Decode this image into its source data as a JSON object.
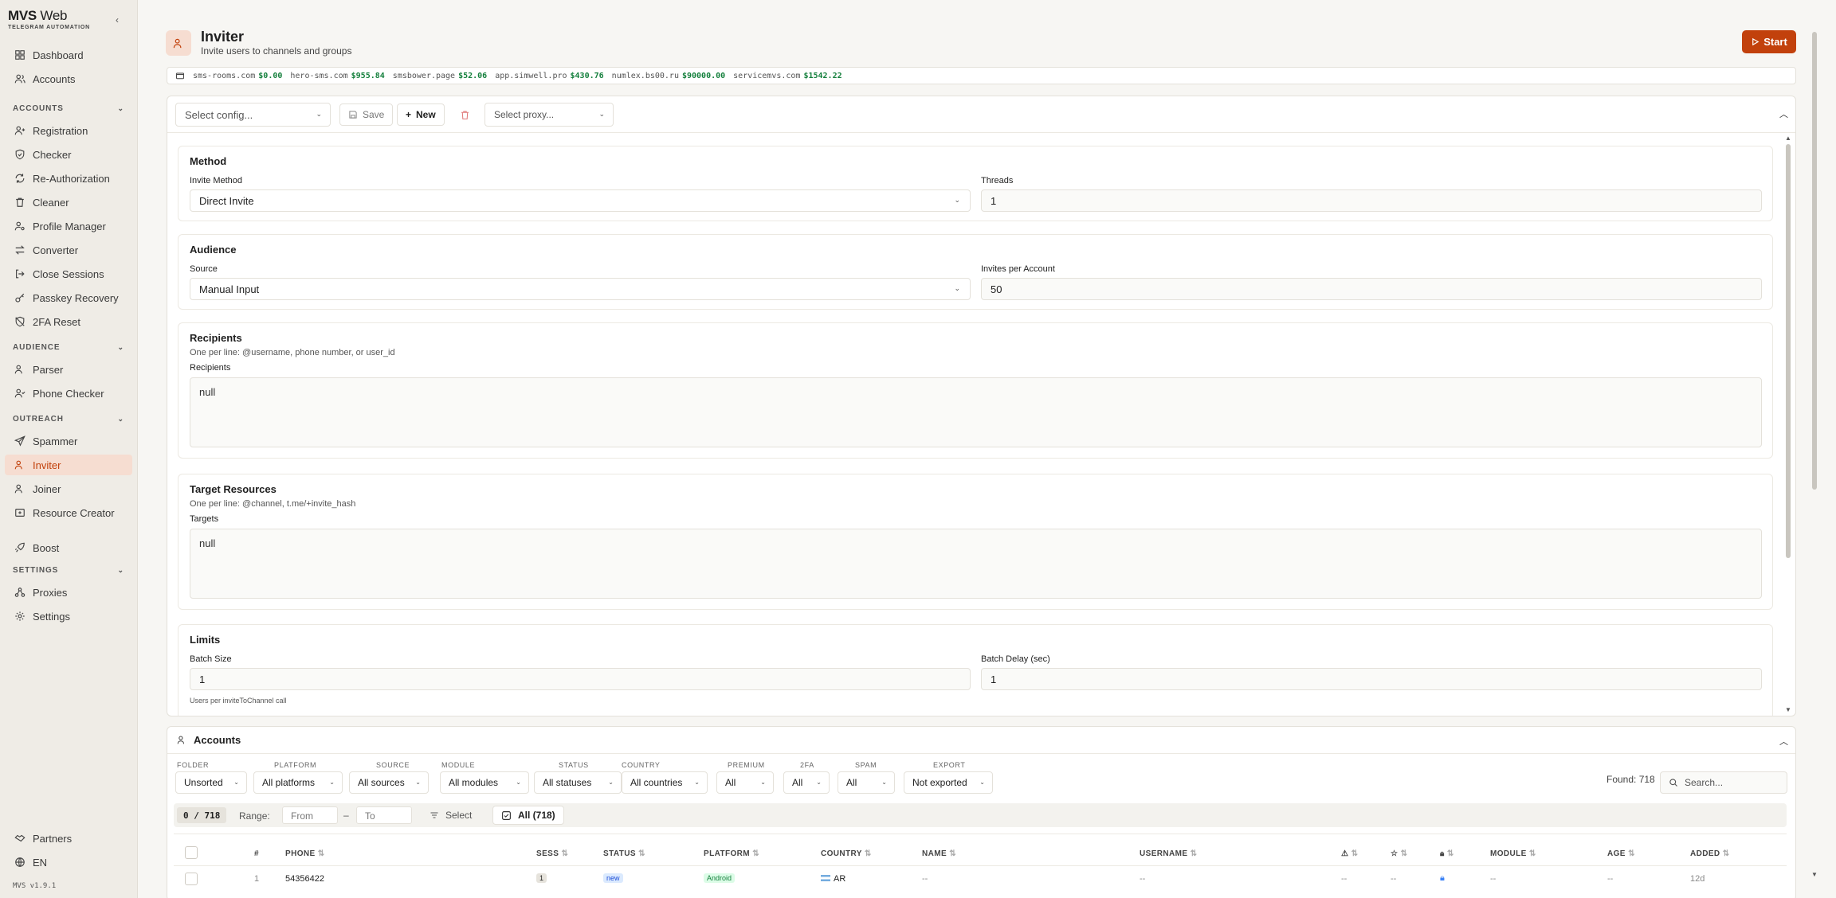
{
  "brand": {
    "name": "MVS",
    "name_suffix": "Web",
    "subtitle": "TELEGRAM AUTOMATION"
  },
  "sidebar": {
    "top": [
      {
        "label": "Dashboard",
        "icon": "dashboard-icon"
      },
      {
        "label": "Accounts",
        "icon": "users-icon"
      }
    ],
    "sections": [
      {
        "title": "ACCOUNTS",
        "items": [
          {
            "label": "Registration",
            "icon": "user-plus-icon"
          },
          {
            "label": "Checker",
            "icon": "shield-check-icon"
          },
          {
            "label": "Re-Authorization",
            "icon": "refresh-icon"
          },
          {
            "label": "Cleaner",
            "icon": "trash-icon"
          },
          {
            "label": "Profile Manager",
            "icon": "user-cog-icon"
          },
          {
            "label": "Converter",
            "icon": "arrows-icon"
          },
          {
            "label": "Close Sessions",
            "icon": "logout-icon"
          },
          {
            "label": "Passkey Recovery",
            "icon": "key-icon"
          },
          {
            "label": "2FA Reset",
            "icon": "shield-off-icon"
          }
        ]
      },
      {
        "title": "AUDIENCE",
        "items": [
          {
            "label": "Parser",
            "icon": "users-icon"
          },
          {
            "label": "Phone Checker",
            "icon": "user-check-icon"
          }
        ]
      },
      {
        "title": "OUTREACH",
        "items": [
          {
            "label": "Spammer",
            "icon": "send-icon"
          },
          {
            "label": "Inviter",
            "icon": "user-plus-icon",
            "active": true
          },
          {
            "label": "Joiner",
            "icon": "users-icon"
          },
          {
            "label": "Resource Creator",
            "icon": "plus-square-icon"
          }
        ]
      }
    ],
    "boost": {
      "label": "Boost",
      "icon": "rocket-icon"
    },
    "settings_section": {
      "title": "SETTINGS",
      "items": [
        {
          "label": "Proxies",
          "icon": "network-icon"
        },
        {
          "label": "Settings",
          "icon": "gear-icon"
        }
      ]
    },
    "footer": [
      {
        "label": "Partners",
        "icon": "handshake-icon"
      },
      {
        "label": "EN",
        "icon": "globe-icon"
      }
    ],
    "version": "MVS v1.9.1"
  },
  "header": {
    "title": "Inviter",
    "subtitle": "Invite users to channels and groups",
    "start_label": "Start"
  },
  "balances": [
    {
      "site": "sms-rooms.com",
      "amount": "$0.00"
    },
    {
      "site": "hero-sms.com",
      "amount": "$955.84"
    },
    {
      "site": "smsbower.page",
      "amount": "$52.06"
    },
    {
      "site": "app.simwell.pro",
      "amount": "$430.76"
    },
    {
      "site": "numlex.bs00.ru",
      "amount": "$90000.00"
    },
    {
      "site": "servicemvs.com",
      "amount": "$1542.22"
    }
  ],
  "toolbar": {
    "config_placeholder": "Select config...",
    "save_label": "Save",
    "new_label": "New",
    "proxy_placeholder": "Select proxy..."
  },
  "method": {
    "title": "Method",
    "invite_method_label": "Invite Method",
    "invite_method_value": "Direct Invite",
    "threads_label": "Threads",
    "threads_value": "1"
  },
  "audience": {
    "title": "Audience",
    "source_label": "Source",
    "source_value": "Manual Input",
    "invites_label": "Invites per Account",
    "invites_value": "50"
  },
  "recipients": {
    "title": "Recipients",
    "hint": "One per line: @username, phone number, or user_id",
    "label": "Recipients",
    "value": "null"
  },
  "targets": {
    "title": "Target Resources",
    "hint": "One per line: @channel, t.me/+invite_hash",
    "label": "Targets",
    "value": "null"
  },
  "limits": {
    "title": "Limits",
    "batch_size_label": "Batch Size",
    "batch_size_value": "1",
    "batch_size_hint": "Users per inviteToChannel call",
    "batch_delay_label": "Batch Delay (sec)",
    "batch_delay_value": "1"
  },
  "accounts": {
    "title": "Accounts",
    "filters": [
      {
        "label": "FOLDER",
        "value": "Unsorted"
      },
      {
        "label": "PLATFORM",
        "value": "All platforms"
      },
      {
        "label": "SOURCE",
        "value": "All sources"
      },
      {
        "label": "MODULE",
        "value": "All modules"
      },
      {
        "label": "STATUS",
        "value": "All statuses"
      },
      {
        "label": "COUNTRY",
        "value": "All countries"
      },
      {
        "label": "PREMIUM",
        "value": "All"
      },
      {
        "label": "2FA",
        "value": "All"
      },
      {
        "label": "SPAM",
        "value": "All"
      },
      {
        "label": "EXPORT",
        "value": "Not exported"
      }
    ],
    "found": "Found: 718",
    "search_placeholder": "Search...",
    "selection": "0 / 718",
    "range_label": "Range:",
    "range_from": "From",
    "range_sep": "–",
    "range_to": "To",
    "select_label": "Select",
    "all_label": "All (718)",
    "columns": [
      "#",
      "PHONE",
      "SESS",
      "STATUS",
      "PLATFORM",
      "COUNTRY",
      "NAME",
      "USERNAME",
      "MODULE",
      "AGE",
      "ADDED"
    ],
    "row": {
      "num": "1",
      "phone": "54356422",
      "sess": "1",
      "status": "new",
      "platform": "Android",
      "country": "AR",
      "name": "--",
      "username": "--",
      "spam": "--",
      "premium": "--",
      "module": "--",
      "age": "--",
      "added": "12d"
    }
  },
  "colors": {
    "accent": "#c2410c",
    "accent_bg": "#f6ddd1",
    "money": "#15803d"
  }
}
